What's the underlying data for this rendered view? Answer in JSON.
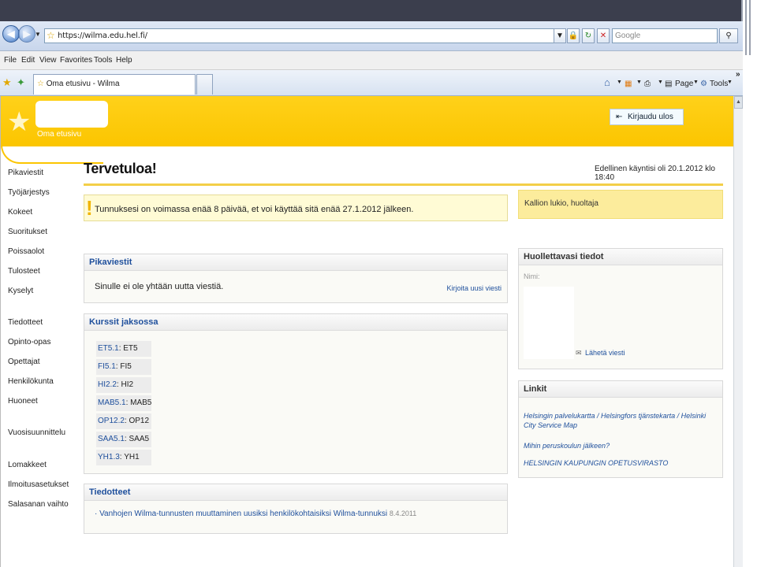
{
  "browser": {
    "url": "https://wilma.edu.hel.fi/",
    "search_placeholder": "Google",
    "menu": [
      "File",
      "Edit",
      "View",
      "Favorites",
      "Tools",
      "Help"
    ],
    "tab_title": "Oma etusivu - Wilma",
    "cmd_page": "Page",
    "cmd_tools": "Tools",
    "cmd_more": "»"
  },
  "header": {
    "home_label": "Oma etusivu",
    "logout_label": "Kirjaudu ulos"
  },
  "sidebar": {
    "groups": [
      [
        "Pikaviestit",
        "Työjärjestys",
        "Kokeet",
        "Suoritukset",
        "Poissaolot",
        "Tulosteet",
        "Kyselyt"
      ],
      [
        "Tiedotteet",
        "Opinto-opas",
        "Opettajat",
        "Henkilökunta",
        "Huoneet"
      ],
      [
        "Vuosisuunnittelu"
      ],
      [
        "Lomakkeet",
        "Ilmoitusasetukset",
        "Salasanan vaihto"
      ]
    ]
  },
  "main": {
    "title": "Tervetuloa!",
    "last_visit": "Edellinen käyntisi oli 20.1.2012 klo 18:40",
    "notice": "Tunnuksesi on voimassa enää 8 päivää, et voi käyttää sitä enää 27.1.2012 jälkeen.",
    "messages": {
      "title": "Pikaviestit",
      "empty_text": "Sinulle ei ole yhtään uutta viestiä.",
      "write_link": "Kirjoita uusi viesti"
    },
    "courses": {
      "title": "Kurssit jaksossa",
      "items": [
        {
          "code": "ET5.1",
          "name": "ET5"
        },
        {
          "code": "FI5.1",
          "name": "FI5"
        },
        {
          "code": "HI2.2",
          "name": "HI2"
        },
        {
          "code": "MAB5.1",
          "name": "MAB5"
        },
        {
          "code": "OP12.2",
          "name": "OP12"
        },
        {
          "code": "SAA5.1",
          "name": "SAA5"
        },
        {
          "code": "YH1.3",
          "name": "YH1"
        }
      ]
    },
    "news": {
      "title": "Tiedotteet",
      "item_text": "Vanhojen Wilma-tunnusten muuttaminen uusiksi henkilökohtaisiksi Wilma-tunnuksi",
      "item_date": "8.4.2011"
    }
  },
  "right": {
    "role": "Kallion lukio, huoltaja",
    "guardian": {
      "title": "Huollettavasi tiedot",
      "name_label": "Nimi:",
      "send_message": "Lähetä viesti"
    },
    "links": {
      "title": "Linkit",
      "items": [
        "Helsingin palvelukartta / Helsingfors tjänstekarta / Helsinki City Service Map",
        "Mihin peruskoulun jälkeen?",
        "HELSINGIN KAUPUNGIN OPETUSVIRASTO"
      ]
    }
  }
}
